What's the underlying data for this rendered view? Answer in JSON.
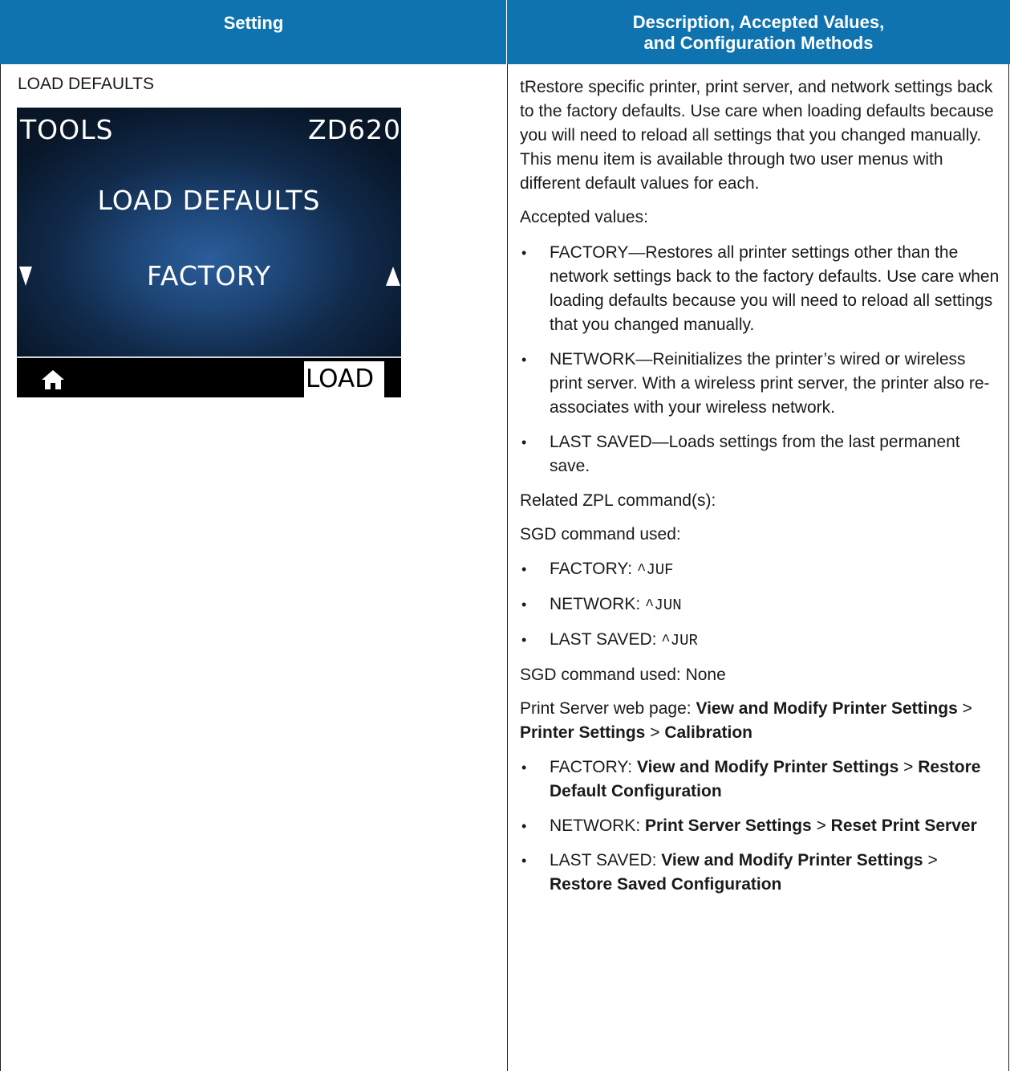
{
  "header": {
    "setting": "Setting",
    "description_line1": "Description, Accepted Values,",
    "description_line2": "and Configuration Methods"
  },
  "setting": {
    "name": "LOAD DEFAULTS"
  },
  "lcd": {
    "menu": "TOOLS",
    "model": "ZD620",
    "title": "LOAD DEFAULTS",
    "value": "FACTORY",
    "load_button": "LOAD",
    "icons": [
      "down-arrow-icon",
      "up-arrow-icon",
      "home-icon"
    ]
  },
  "description": {
    "intro": "tRestore specific printer, print server, and network settings back to the factory defaults. Use care when loading defaults because you will need to reload all settings that you changed manually. This menu item is available through two user menus with different default values for each.",
    "accepted_label": "Accepted values:",
    "accepted": [
      "FACTORY—Restores all printer settings other than the network settings back to the factory defaults. Use care when loading defaults because you will need to reload all settings that you changed manually.",
      "NETWORK—Reinitializes the printer’s wired or wireless print server. With a wireless print server, the printer also re-associates with your wireless network.",
      "LAST SAVED—Loads settings from the last permanent save."
    ],
    "zpl_label": "Related ZPL command(s):",
    "sgd_label": "SGD command used:",
    "commands": [
      {
        "label": "FACTORY: ",
        "code": "^JUF"
      },
      {
        "label": "NETWORK: ",
        "code": "^JUN"
      },
      {
        "label": "LAST SAVED: ",
        "code": "^JUR"
      }
    ],
    "sgd_none": "SGD command used: None",
    "web": {
      "prefix": "Print Server web page: ",
      "p1": "View and Modify Printer Settings",
      "sep1": " > ",
      "p2": "Printer Settings",
      "sep2": " > ",
      "p3": "Calibration"
    },
    "web_items": [
      {
        "label": "FACTORY: ",
        "a": "View and Modify Printer Settings",
        "sep": " > ",
        "b": "Restore Default Configuration"
      },
      {
        "label": "NETWORK: ",
        "a": "Print Server Settings",
        "sep": " > ",
        "b": "Reset Print Server"
      },
      {
        "label": "LAST SAVED: ",
        "a": "View and Modify Printer Settings",
        "sep": " > ",
        "b": "Restore Saved Configuration"
      }
    ]
  }
}
